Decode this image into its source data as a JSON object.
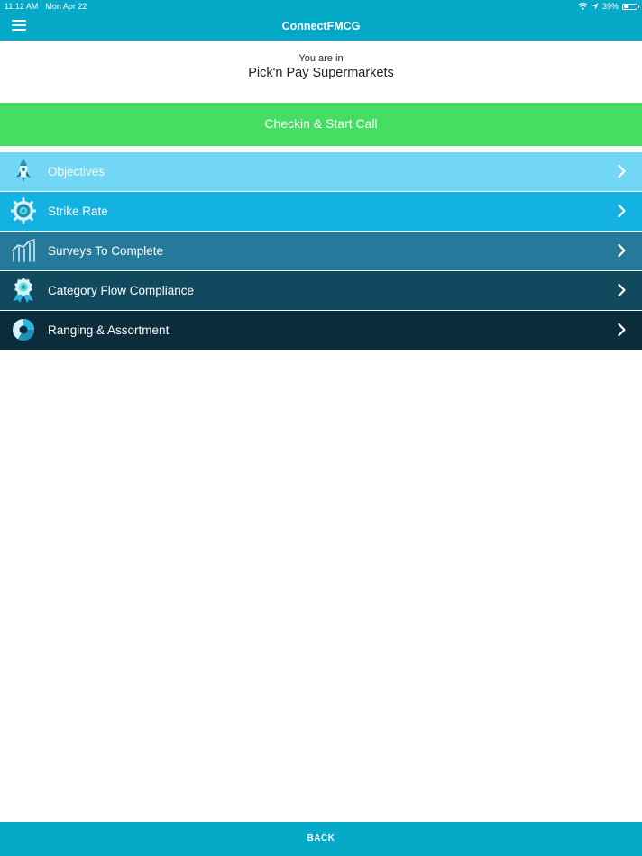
{
  "status_bar": {
    "time": "11:12 AM",
    "date": "Mon Apr 22",
    "battery_percent": "39%",
    "battery_level": 0.39,
    "icons": [
      "wifi-icon",
      "location-arrow-icon",
      "battery-icon"
    ]
  },
  "navbar": {
    "title": "ConnectFMCG",
    "menu_icon": "hamburger-menu-icon"
  },
  "store": {
    "prefix": "You are in",
    "name": "Pick'n Pay Supermarkets"
  },
  "checkin": {
    "label": "Checkin & Start Call",
    "color": "#45dd62"
  },
  "menu": {
    "items": [
      {
        "label": "Objectives",
        "icon": "rocket-icon",
        "color": "#72d6f5"
      },
      {
        "label": "Strike Rate",
        "icon": "target-gear-icon",
        "color": "#14b2e2"
      },
      {
        "label": "Surveys To Complete",
        "icon": "bar-chart-icon",
        "color": "#25799a"
      },
      {
        "label": "Category Flow Compliance",
        "icon": "award-badge-icon",
        "color": "#11495e"
      },
      {
        "label": "Ranging & Assortment",
        "icon": "donut-chart-icon",
        "color": "#0a2c3b"
      }
    ],
    "chevron_icon": "chevron-right-icon"
  },
  "back": {
    "label": "BACK"
  },
  "colors": {
    "header": "#05a9c8",
    "background": "#ffffff"
  }
}
